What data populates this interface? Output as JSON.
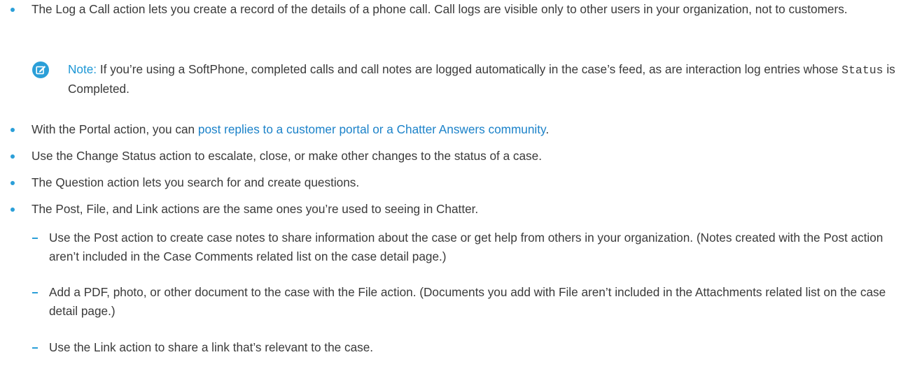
{
  "colors": {
    "accent": "#2b9fd8",
    "link": "#1b82c9",
    "text": "#3a3a3a"
  },
  "icons": {
    "note": "edit-note-icon"
  },
  "items": [
    {
      "text": "The Log a Call action lets you create a record of the details of a phone call. Call logs are visible only to other users in your organization, not to customers."
    },
    {
      "before": "With the Portal action, you can ",
      "link": "post replies to a customer portal or a Chatter Answers community",
      "after": "."
    },
    {
      "text": "Use the Change Status action to escalate, close, or make other changes to the status of a case."
    },
    {
      "text": "The Question action lets you search for and create questions."
    },
    {
      "text": "The Post, File, and Link actions are the same ones you’re used to seeing in Chatter."
    }
  ],
  "note": {
    "label": "Note:",
    "text_before": " If you’re using a SoftPhone, completed calls and call notes are logged automatically in the case’s feed, as are interaction log entries whose ",
    "code": "Status",
    "text_after": " is Completed."
  },
  "subitems": [
    {
      "text": "Use the Post action to create case notes to share information about the case or get help from others in your organization. (Notes created with the Post action aren’t included in the Case Comments related list on the case detail page.)"
    },
    {
      "text": "Add a PDF, photo, or other document to the case with the File action. (Documents you add with File aren’t included in the Attachments related list on the case detail page.)"
    },
    {
      "text": "Use the Link action to share a link that’s relevant to the case."
    }
  ]
}
